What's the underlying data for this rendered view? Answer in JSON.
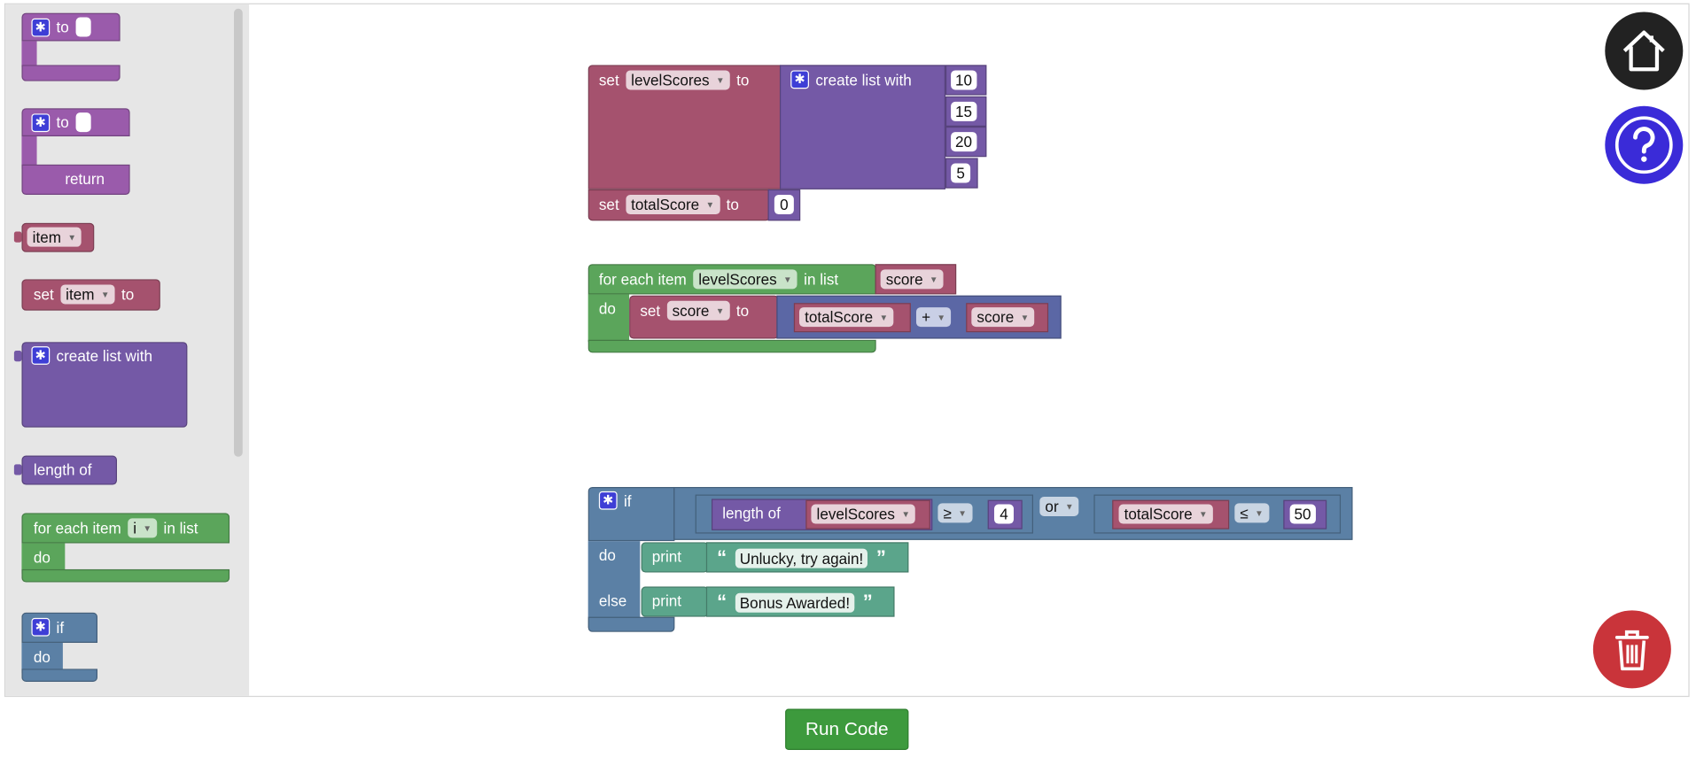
{
  "colors": {
    "list": "#7459a6",
    "variable": "#a5526e",
    "loop": "#5ba55b",
    "logic": "#5b80a5",
    "text": "#5ba58b",
    "procedure": "#9a5bab",
    "run": "#3d9a3d",
    "trash": "#c9343a",
    "help": "#3a2bd8",
    "home": "#222222"
  },
  "icons": {
    "home": "home-icon",
    "help": "question-icon",
    "trash": "trash-icon",
    "gear": "gear-icon"
  },
  "flyout": {
    "proc_to": "to",
    "func_to": "to",
    "func_return": "return",
    "var_get": "item",
    "var_set_kw": "set",
    "var_set_name": "item",
    "var_set_to": "to",
    "create_list": "create list with",
    "length_of": "length of",
    "foreach_kw": "for each item",
    "foreach_var": "i",
    "foreach_inlist": "in list",
    "foreach_do": "do",
    "if_kw": "if",
    "if_do": "do"
  },
  "workspace": {
    "set1_kw": "set",
    "set1_var": "levelScores",
    "set1_to": "to",
    "create_list": "create list with",
    "list_items": [
      "10",
      "15",
      "20",
      "5"
    ],
    "set2_kw": "set",
    "set2_var": "totalScore",
    "set2_to": "to",
    "set2_val": "0",
    "foreach_kw": "for each item",
    "foreach_var": "levelScores",
    "foreach_inlist": "in list",
    "foreach_list": "score",
    "foreach_do": "do",
    "inner_set_kw": "set",
    "inner_set_var": "score",
    "inner_set_to": "to",
    "arith_a": "totalScore",
    "arith_op": "+",
    "arith_b": "score",
    "if_kw": "if",
    "length_of": "length of",
    "len_var": "levelScores",
    "cmp1_op": "≥",
    "cmp1_val": "4",
    "or_op": "or",
    "cmp2_var": "totalScore",
    "cmp2_op": "≤",
    "cmp2_val": "50",
    "do_kw": "do",
    "else_kw": "else",
    "print1": "print",
    "text1": "Unlucky, try again!",
    "print2": "print",
    "text2": "Bonus Awarded!"
  },
  "run_button": "Run Code"
}
